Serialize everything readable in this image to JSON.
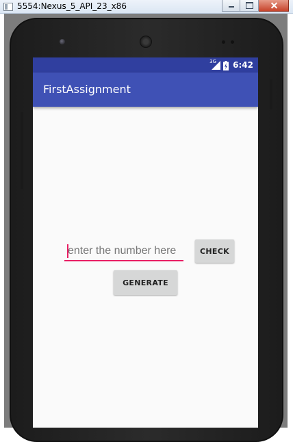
{
  "window": {
    "title": "5554:Nexus_5_API_23_x86"
  },
  "status_bar": {
    "network_label": "3G",
    "time": "6:42"
  },
  "app_bar": {
    "title": "FirstAssignment"
  },
  "form": {
    "number_placeholder": "enter the number here",
    "number_value": "",
    "check_label": "CHECK",
    "generate_label": "GENERATE"
  },
  "colors": {
    "status_bar": "#303f9f",
    "app_bar": "#3f51b5",
    "accent": "#e91e63",
    "button": "#d6d7d7"
  }
}
